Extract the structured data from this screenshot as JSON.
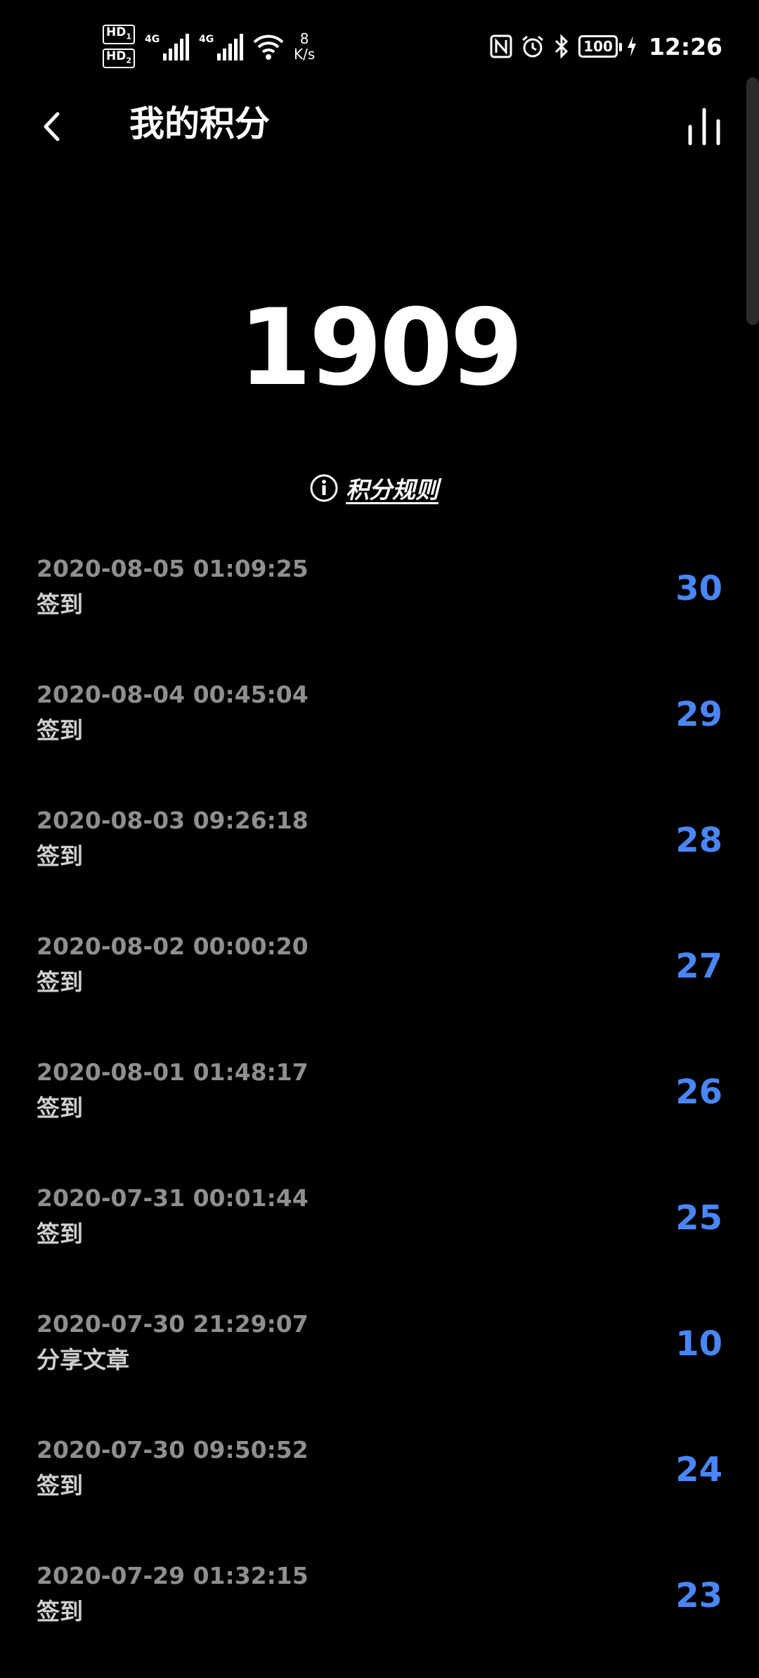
{
  "status_bar": {
    "hd1": "HD",
    "hd2": "HD",
    "sim1_sub": "1",
    "sim2_sub": "2",
    "network1": "4G",
    "network2": "4G",
    "net_speed_value": "8",
    "net_speed_unit": "K/s",
    "battery": "100",
    "time": "12:26"
  },
  "header": {
    "title": "我的积分"
  },
  "points": {
    "total": "1909",
    "rules_label": "积分规则"
  },
  "colors": {
    "background": "#000000",
    "accent_points": "#4a86f7",
    "date_text": "#8f8f8f",
    "desc_text": "#cfcfcf"
  },
  "records": [
    {
      "datetime": "2020-08-05 01:09:25",
      "type": "签到",
      "points": "30"
    },
    {
      "datetime": "2020-08-04 00:45:04",
      "type": "签到",
      "points": "29"
    },
    {
      "datetime": "2020-08-03 09:26:18",
      "type": "签到",
      "points": "28"
    },
    {
      "datetime": "2020-08-02 00:00:20",
      "type": "签到",
      "points": "27"
    },
    {
      "datetime": "2020-08-01 01:48:17",
      "type": "签到",
      "points": "26"
    },
    {
      "datetime": "2020-07-31 00:01:44",
      "type": "签到",
      "points": "25"
    },
    {
      "datetime": "2020-07-30 21:29:07",
      "type": "分享文章",
      "points": "10"
    },
    {
      "datetime": "2020-07-30 09:50:52",
      "type": "签到",
      "points": "24"
    },
    {
      "datetime": "2020-07-29 01:32:15",
      "type": "签到",
      "points": "23"
    }
  ]
}
